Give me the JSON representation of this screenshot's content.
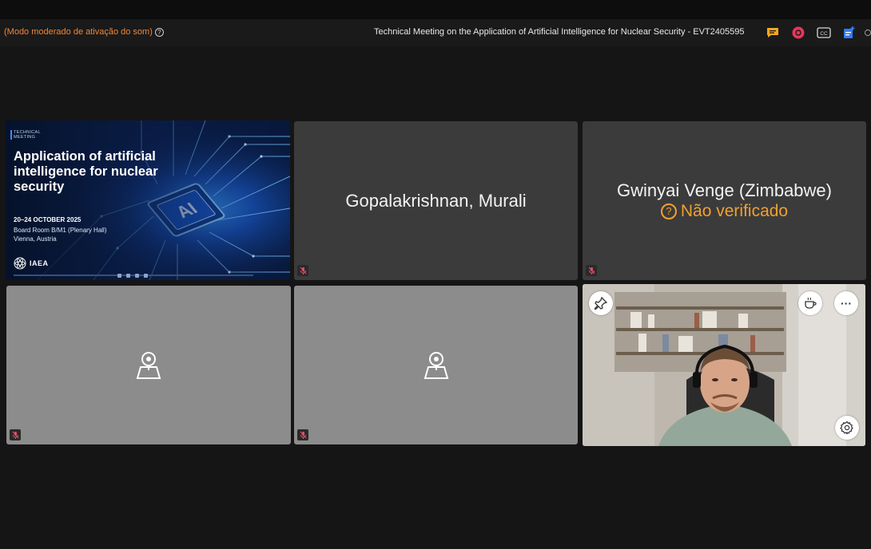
{
  "header": {
    "audio_mode_label": "(Modo moderado de ativação do som)",
    "help_symbol": "?",
    "meeting_title": "Technical Meeting on the Application of Artificial Intelligence for Nuclear Security - EVT2405595",
    "icons": [
      "chat-icon",
      "record-icon",
      "captions-icon",
      "share-icon",
      "menu-icon"
    ],
    "captions_label": "CC"
  },
  "slide": {
    "tag_line1": "TECHNICAL",
    "tag_line2": "MEETING",
    "title": "Application of artificial intelligence for nuclear security",
    "chip_label": "AI",
    "date": "20–24 OCTOBER 2025",
    "location_line1": "Board Room B/M1 (Plenary Hall)",
    "location_line2": "Vienna, Austria",
    "logo_text": "IAEA"
  },
  "participants": [
    {
      "name": "Gopalakrishnan, Murali"
    },
    {
      "name": "Gwinyai Venge (Zimbabwe)",
      "status": "Não verificado",
      "status_symbol": "?"
    }
  ],
  "webcam_tile": {
    "icons": [
      "pin-icon",
      "coffee-icon",
      "more-icon",
      "settings-icon"
    ],
    "more_symbol": "···"
  },
  "colors": {
    "accent_orange": "#f0873a",
    "unverified_yellow": "#f0a030",
    "tile_dark": "#3b3b3b",
    "tile_light": "#8c8c8c",
    "mic_muted_red": "#e0506a"
  }
}
